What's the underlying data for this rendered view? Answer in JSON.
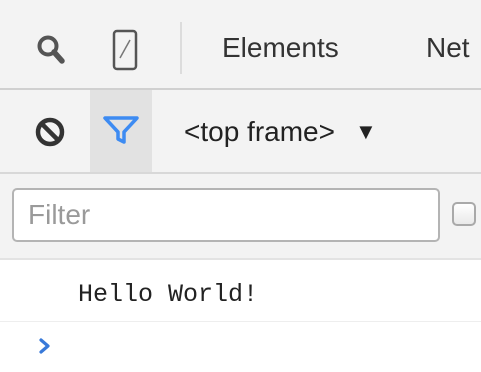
{
  "main_toolbar": {
    "tabs": [
      {
        "label": "Elements"
      },
      {
        "label": "Net"
      }
    ]
  },
  "console_toolbar": {
    "frame_selector": {
      "value": "<top frame>",
      "caret": "▼"
    }
  },
  "filter_bar": {
    "filter": {
      "placeholder": "Filter",
      "value": ""
    }
  },
  "console": {
    "messages": [
      {
        "text": "Hello World!"
      }
    ]
  },
  "colors": {
    "toolbar_bg": "#f3f3f3",
    "filter_active": "#3d8bf2",
    "prompt": "#3879d9"
  }
}
